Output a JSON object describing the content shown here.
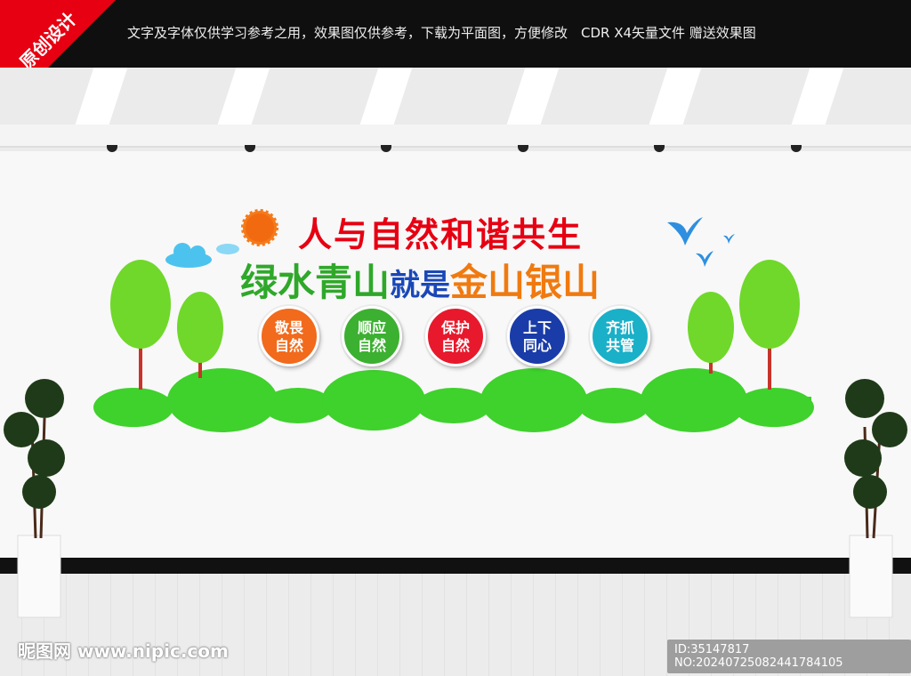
{
  "badge": "原创设计",
  "notice": "文字及字体仅供学习参考之用，效果图仅供参考，下载为平面图，方便修改　CDR X4矢量文件  赠送效果图",
  "title_line1": "人与自然和谐共生",
  "title_line2": {
    "part1": "绿水青山",
    "part2": "就是",
    "part3": "金山银山"
  },
  "colors": {
    "red": "#e60012",
    "green": "#2fa82a",
    "blue": "#1a47b8",
    "orange": "#f07a10"
  },
  "circles": [
    {
      "line1": "敬畏",
      "line2": "自然",
      "color": "#f26a1b"
    },
    {
      "line1": "顺应",
      "line2": "自然",
      "color": "#3cb030"
    },
    {
      "line1": "保护",
      "line2": "自然",
      "color": "#e8192c"
    },
    {
      "line1": "上下",
      "line2": "同心",
      "color": "#1a3ca8"
    },
    {
      "line1": "齐抓",
      "line2": "共管",
      "color": "#1ab0c8"
    }
  ],
  "watermark": "昵图网 www.nipic.com",
  "id_text": "ID:35147817 NO:20240725082441784105"
}
